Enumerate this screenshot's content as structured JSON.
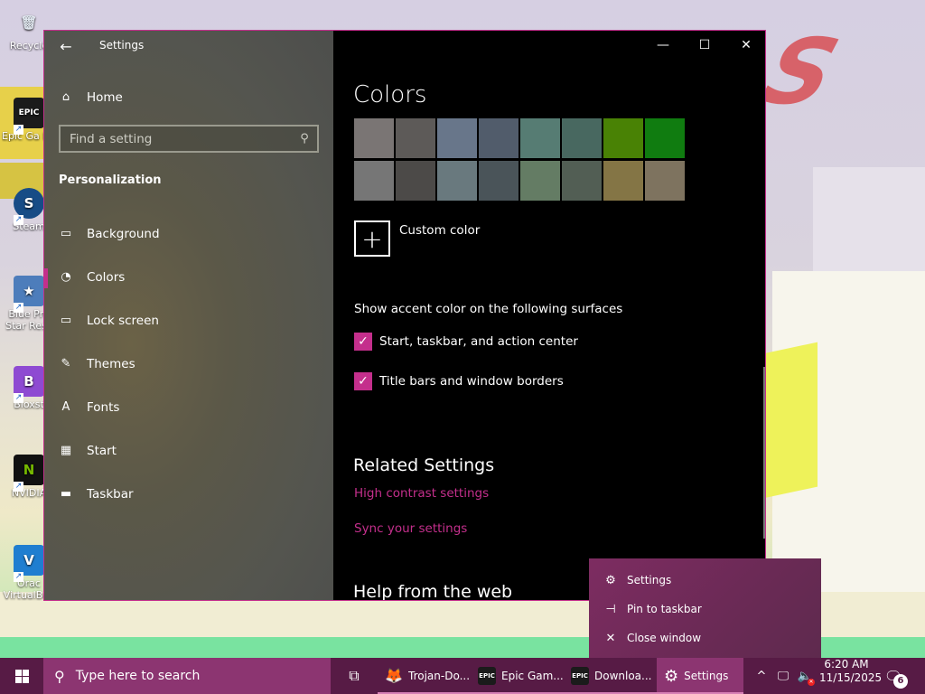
{
  "desktop": {
    "icons": [
      {
        "label": "Recycle",
        "glyph": "🗑",
        "color": "#ffffff"
      },
      {
        "label": "Epic Ga Launc",
        "glyph": "EPIC",
        "color": "#1b1b1b"
      },
      {
        "label": "Steam",
        "glyph": "S",
        "color": "#174c86"
      },
      {
        "label": "Blue Pro Star Resc",
        "glyph": "★",
        "color": "#4d7dbb"
      },
      {
        "label": "Bloxst",
        "glyph": "B",
        "color": "#8e4ad2"
      },
      {
        "label": "NVIDIA",
        "glyph": "N",
        "color": "#111111"
      },
      {
        "label": "Orac VirtualBox",
        "glyph": "V",
        "color": "#1f7ed0"
      }
    ],
    "wallpaper_letter": "S"
  },
  "window": {
    "title": "Settings",
    "back_icon": "←",
    "minimize_icon": "—",
    "maximize_icon": "☐",
    "close_icon": "✕",
    "accent_color": "#c42f8c"
  },
  "sidebar": {
    "home_label": "Home",
    "home_icon": "⌂",
    "search_placeholder": "Find a setting",
    "search_icon": "⚲",
    "section_heading": "Personalization",
    "items": [
      {
        "label": "Background",
        "icon": "▭",
        "selected": false
      },
      {
        "label": "Colors",
        "icon": "◔",
        "selected": true
      },
      {
        "label": "Lock screen",
        "icon": "▭",
        "selected": false
      },
      {
        "label": "Themes",
        "icon": "✎",
        "selected": false
      },
      {
        "label": "Fonts",
        "icon": "A",
        "selected": false
      },
      {
        "label": "Start",
        "icon": "▦",
        "selected": false
      },
      {
        "label": "Taskbar",
        "icon": "▬",
        "selected": false
      }
    ]
  },
  "main": {
    "title": "Colors",
    "swatches": [
      [
        "#7a7574",
        "#5d5a58",
        "#68768a",
        "#515c6b",
        "#567c73",
        "#486860",
        "#498205",
        "#107c10"
      ],
      [
        "#767676",
        "#4c4a48",
        "#69797e",
        "#4a5459",
        "#647c64",
        "#525e54",
        "#847545",
        "#7e735f"
      ]
    ],
    "custom_color_label": "Custom color",
    "custom_color_icon": "+",
    "surfaces_label": "Show accent color on the following surfaces",
    "checkboxes": [
      {
        "label": "Start, taskbar, and action center",
        "checked": true
      },
      {
        "label": "Title bars and window borders",
        "checked": true
      }
    ],
    "related_heading": "Related Settings",
    "links": [
      "High contrast settings",
      "Sync your settings"
    ],
    "help_heading": "Help from the web"
  },
  "jumplist": {
    "items": [
      {
        "label": "Settings",
        "icon": "⚙"
      },
      {
        "label": "Pin to taskbar",
        "icon": "⊣"
      },
      {
        "label": "Close window",
        "icon": "✕"
      }
    ]
  },
  "taskbar": {
    "search_placeholder": "Type here to search",
    "search_icon": "⚲",
    "taskview_icon": "⧉",
    "apps": [
      {
        "label": "Trojan-Do...",
        "icon": "🦊",
        "color": "#e8691d"
      },
      {
        "label": "Epic Gam...",
        "icon": "EPIC",
        "color": "#1b1b1b"
      },
      {
        "label": "Downloa...",
        "icon": "EPIC",
        "color": "#1b1b1b"
      }
    ],
    "active_app": {
      "label": "Settings",
      "icon": "⚙"
    },
    "tray": {
      "chevron": "^",
      "network": "🖵",
      "volume": "🔈"
    },
    "clock": {
      "time": "6:20 AM",
      "date": "11/15/2025"
    },
    "notification_icon": "🗨",
    "notification_count": "6"
  }
}
